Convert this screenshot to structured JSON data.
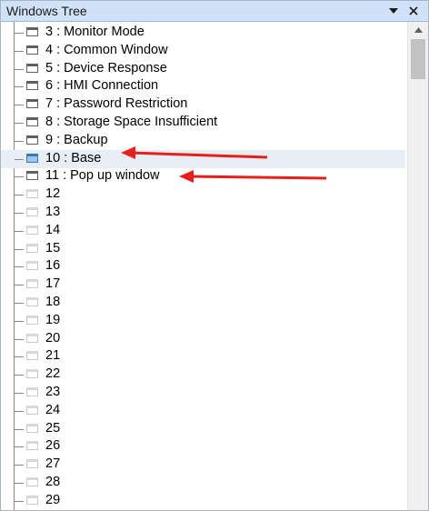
{
  "panel": {
    "title": "Windows Tree",
    "pin_icon": "dropdown-triangle-icon",
    "close_icon": "close-icon"
  },
  "tree": {
    "items": [
      {
        "label": "3 : Monitor Mode",
        "state": "named"
      },
      {
        "label": "4 : Common Window",
        "state": "named"
      },
      {
        "label": "5 : Device Response",
        "state": "named"
      },
      {
        "label": "6 : HMI Connection",
        "state": "named"
      },
      {
        "label": "7 : Password Restriction",
        "state": "named"
      },
      {
        "label": "8 : Storage Space Insufficient",
        "state": "named"
      },
      {
        "label": "9 : Backup",
        "state": "named"
      },
      {
        "label": "10 : Base",
        "state": "active"
      },
      {
        "label": "11 : Pop up window",
        "state": "named"
      },
      {
        "label": "12",
        "state": "empty"
      },
      {
        "label": "13",
        "state": "empty"
      },
      {
        "label": "14",
        "state": "empty"
      },
      {
        "label": "15",
        "state": "empty"
      },
      {
        "label": "16",
        "state": "empty"
      },
      {
        "label": "17",
        "state": "empty"
      },
      {
        "label": "18",
        "state": "empty"
      },
      {
        "label": "19",
        "state": "empty"
      },
      {
        "label": "20",
        "state": "empty"
      },
      {
        "label": "21",
        "state": "empty"
      },
      {
        "label": "22",
        "state": "empty"
      },
      {
        "label": "23",
        "state": "empty"
      },
      {
        "label": "24",
        "state": "empty"
      },
      {
        "label": "25",
        "state": "empty"
      },
      {
        "label": "26",
        "state": "empty"
      },
      {
        "label": "27",
        "state": "empty"
      },
      {
        "label": "28",
        "state": "empty"
      },
      {
        "label": "29",
        "state": "empty"
      }
    ],
    "selected_index": 7
  },
  "annotations": {
    "arrow_color": "#e8201c",
    "arrow_targets": [
      "10 : Base",
      "11 : Pop up window"
    ]
  },
  "colors": {
    "titlebar": "#cfe2f7",
    "selection": "#e8eef6",
    "active_icon": "#9cc6ee"
  }
}
